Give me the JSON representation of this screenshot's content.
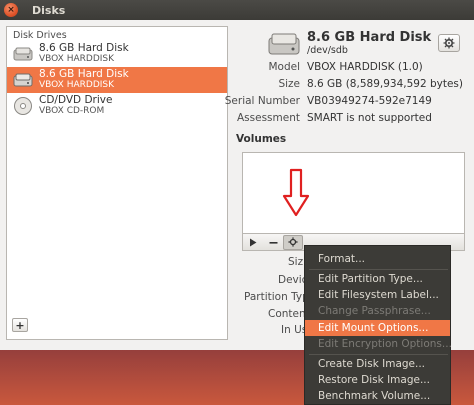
{
  "window": {
    "title": "Disks",
    "close_glyph": "×"
  },
  "sidebar": {
    "section_label": "Disk Drives",
    "items": [
      {
        "name": "8.6 GB Hard Disk",
        "sub": "VBOX HARDDISK",
        "icon": "hard-disk-icon",
        "selected": false
      },
      {
        "name": "8.6 GB Hard Disk",
        "sub": "VBOX HARDDISK",
        "icon": "hard-disk-icon",
        "selected": true
      },
      {
        "name": "CD/DVD Drive",
        "sub": "VBOX CD-ROM",
        "icon": "optical-drive-icon",
        "selected": false
      }
    ],
    "add_label": "+"
  },
  "disk": {
    "title": "8.6 GB Hard Disk",
    "device": "/dev/sdb",
    "properties": [
      {
        "label": "Model",
        "value": "VBOX HARDDISK (1.0)"
      },
      {
        "label": "Size",
        "value": "8.6 GB (8,589,934,592 bytes)"
      },
      {
        "label": "Serial Number",
        "value": "VB03949274-592e7149"
      },
      {
        "label": "Assessment",
        "value": "SMART is not supported"
      }
    ]
  },
  "volumes": {
    "heading": "Volumes",
    "partial_labels": [
      "Siz",
      "Devic",
      "Partition Typ",
      "Conten",
      "In Us"
    ]
  },
  "context_menu": {
    "items": [
      {
        "label": "Format...",
        "state": "normal"
      },
      {
        "label": "Edit Partition Type...",
        "state": "normal"
      },
      {
        "label": "Edit Filesystem Label...",
        "state": "normal"
      },
      {
        "label": "Change Passphrase...",
        "state": "disabled"
      },
      {
        "label": "Edit Mount Options...",
        "state": "highlighted"
      },
      {
        "label": "Edit Encryption Options...",
        "state": "disabled"
      },
      {
        "label": "Create Disk Image...",
        "state": "normal"
      },
      {
        "label": "Restore Disk Image...",
        "state": "normal"
      },
      {
        "label": "Benchmark Volume...",
        "state": "normal"
      }
    ]
  },
  "colors": {
    "accent": "#f07746",
    "annotation_arrow": "#e02020",
    "menu_bg": "#3c3b37"
  }
}
